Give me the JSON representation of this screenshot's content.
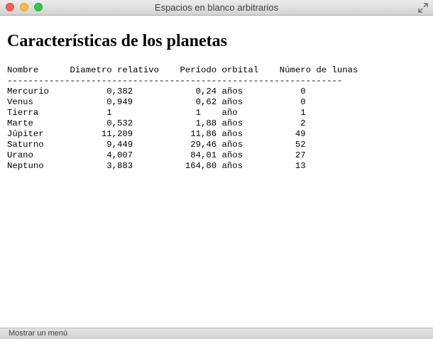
{
  "window": {
    "title": "Espacios en blanco arbitrarios"
  },
  "page": {
    "heading": "Características de los planetas",
    "table": {
      "header": "Nombre      Diametro relativo    Período orbital    Número de lunas",
      "separator": "----------------------------------------------------------------",
      "rows": [
        "Mercurio           0,382            0,24 años           0",
        "Venus              0,949            0,62 años           0",
        "Tierra             1                1    año            1",
        "Marte              0,532            1,88 años           2",
        "Júpiter           11,209           11,86 años          49",
        "Saturno            9,449           29,46 años          52",
        "Urano              4,007           84,01 años          27",
        "Neptuno            3,883          164,80 años          13"
      ]
    }
  },
  "statusbar": {
    "text": "Mostrar un menú"
  }
}
